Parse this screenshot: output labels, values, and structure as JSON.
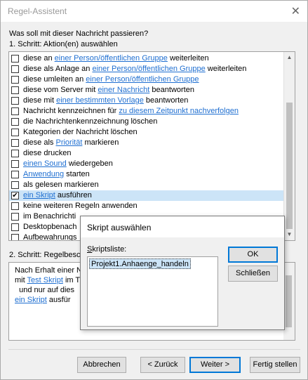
{
  "window": {
    "title": "Regel-Assistent",
    "close": "✕"
  },
  "prompt": "Was soll mit dieser Nachricht passieren?",
  "step1": "1. Schritt: Aktion(en) auswählen",
  "actions": [
    {
      "pre": "diese an ",
      "link": "einer Person/öffentlichen Gruppe",
      "post": " weiterleiten",
      "checked": false
    },
    {
      "pre": "diese als Anlage an ",
      "link": "einer Person/öffentlichen Gruppe",
      "post": " weiterleiten",
      "checked": false
    },
    {
      "pre": "diese umleiten an ",
      "link": "einer Person/öffentlichen Gruppe",
      "post": "",
      "checked": false
    },
    {
      "pre": "diese vom Server mit ",
      "link": "einer Nachricht",
      "post": " beantworten",
      "checked": false
    },
    {
      "pre": "diese mit ",
      "link": "einer bestimmten Vorlage",
      "post": " beantworten",
      "checked": false
    },
    {
      "pre": "Nachricht kennzeichnen für ",
      "link": "zu diesem Zeitpunkt nachverfolgen",
      "post": "",
      "checked": false
    },
    {
      "pre": "die Nachrichtenkennzeichnung löschen",
      "link": "",
      "post": "",
      "checked": false
    },
    {
      "pre": "Kategorien der Nachricht löschen",
      "link": "",
      "post": "",
      "checked": false
    },
    {
      "pre": "diese als ",
      "link": "Priorität",
      "post": " markieren",
      "checked": false
    },
    {
      "pre": "diese drucken",
      "link": "",
      "post": "",
      "checked": false
    },
    {
      "pre": "",
      "link": "einen Sound",
      "post": " wiedergeben",
      "checked": false
    },
    {
      "pre": "",
      "link": "Anwendung",
      "post": " starten",
      "checked": false
    },
    {
      "pre": "als gelesen markieren",
      "link": "",
      "post": "",
      "checked": false
    },
    {
      "pre": "",
      "link": "ein Skript",
      "post": " ausführen",
      "checked": true
    },
    {
      "pre": "keine weiteren Regeln anwenden",
      "link": "",
      "post": "",
      "checked": false
    },
    {
      "pre": "im Benachrichti",
      "link": "",
      "post": "",
      "checked": false
    },
    {
      "pre": "Desktopbenach",
      "link": "",
      "post": "",
      "checked": false
    },
    {
      "pre": "Aufbewahrungs",
      "link": "",
      "post": "",
      "checked": false
    }
  ],
  "step2": "2. Schritt: Regelbesc",
  "description": {
    "line1": "Nach Erhalt einer N",
    "line2_pre": "mit ",
    "line2_link": "Test Skript",
    "line2_post": " im T",
    "line3": "  und nur auf dies",
    "line4_link": "ein Skript",
    "line4_post": " ausfür"
  },
  "buttons": {
    "cancel": "Abbrechen",
    "back": "< Zurück",
    "next": "Weiter >",
    "finish": "Fertig stellen"
  },
  "dialog": {
    "title": "Skript auswählen",
    "list_label_underlined": "S",
    "list_label_rest": "kriptsliste:",
    "scripts": [
      "Projekt1.Anhaenge_handeln"
    ],
    "ok": "OK",
    "close": "Schließen"
  }
}
